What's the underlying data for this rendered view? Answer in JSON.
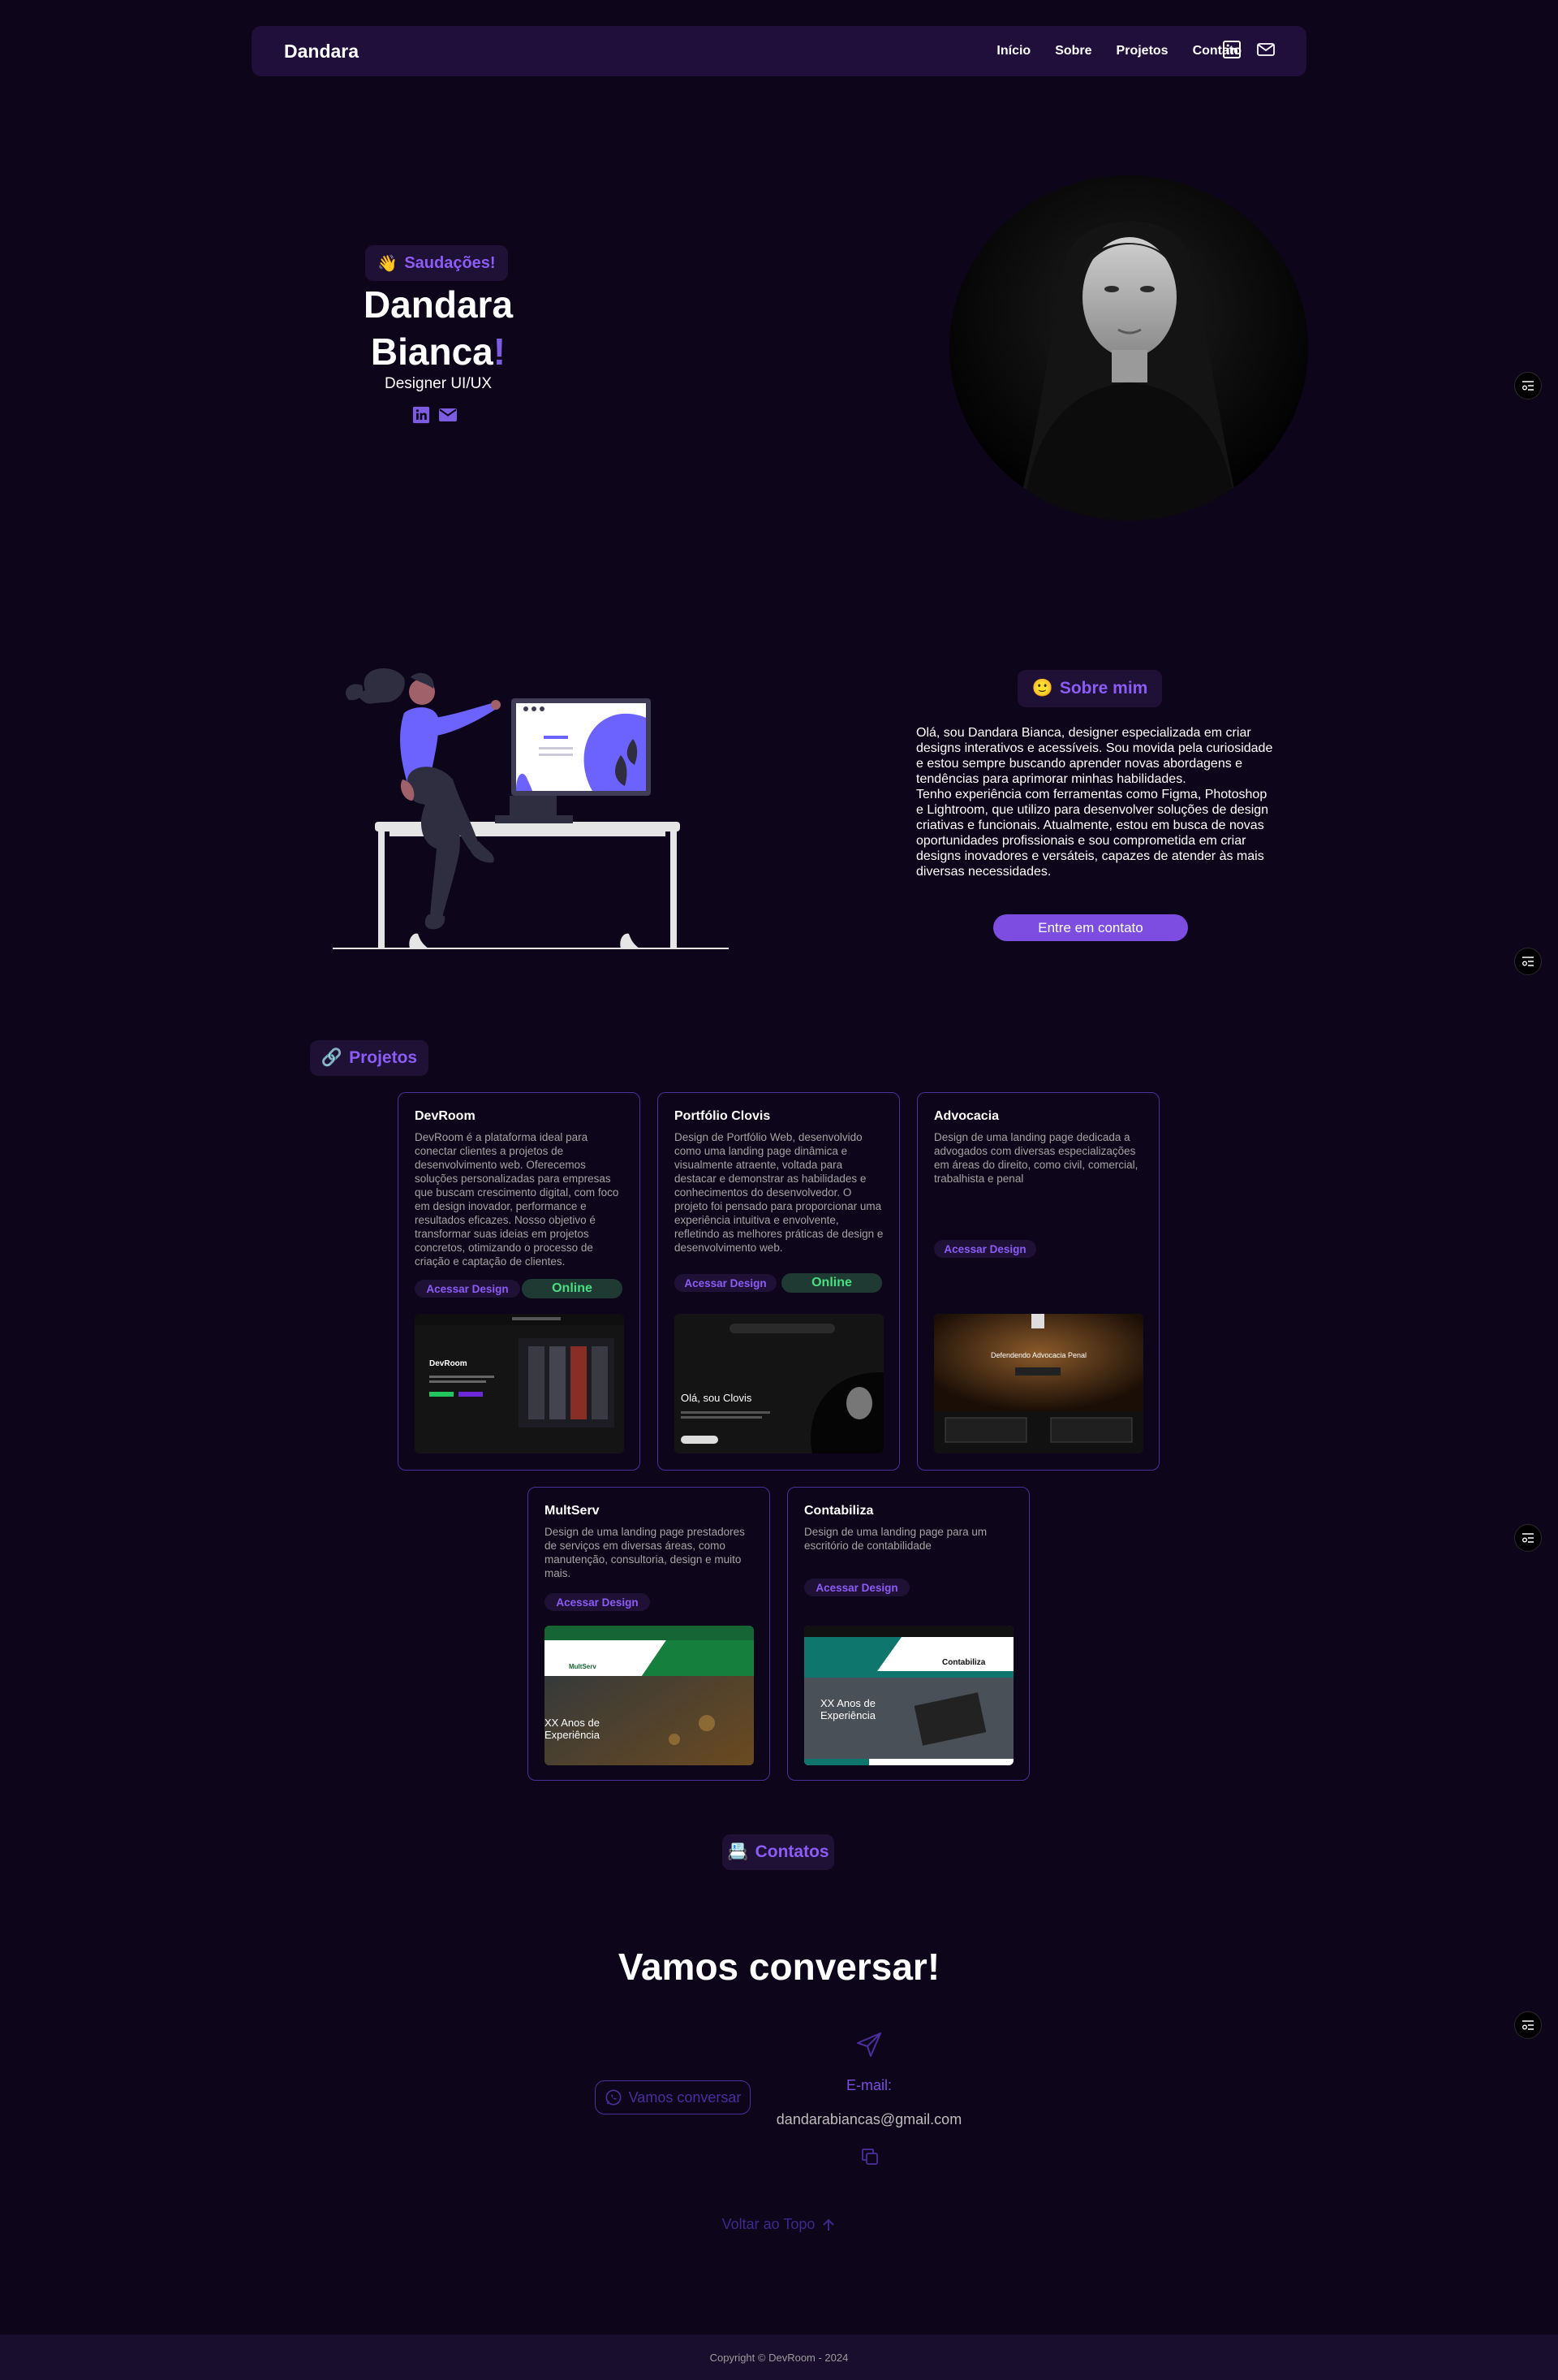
{
  "nav": {
    "brand": "Dandara",
    "links": [
      "Início",
      "Sobre",
      "Projetos",
      "Contato"
    ],
    "icons": [
      "linkedin-icon",
      "mail-icon"
    ]
  },
  "hero": {
    "greeting_emoji": "👋",
    "greeting": "Saudações!",
    "name_line1": "Dandara",
    "name_line2": "Bianca",
    "name_accent": "!",
    "role": "Designer UI/UX"
  },
  "about": {
    "pill_emoji": "🙂",
    "pill": "Sobre mim",
    "paragraph1": "Olá, sou Dandara Bianca, designer especializada em criar designs interativos e acessíveis. Sou movida pela curiosidade e estou sempre buscando aprender novas abordagens e tendências para aprimorar minhas habilidades.",
    "paragraph2": "Tenho experiência com ferramentas como Figma, Photoshop e Lightroom, que utilizo para desenvolver soluções de design criativas e funcionais. Atualmente, estou em busca de novas oportunidades profissionais e sou comprometida em criar designs inovadores e versáteis, capazes de atender às mais diversas necessidades.",
    "cta": "Entre em contato"
  },
  "projects": {
    "pill_emoji": "🔗",
    "pill": "Projetos",
    "access_label": "Acessar Design",
    "online_label": "Online",
    "cards": [
      {
        "title": "DevRoom",
        "desc": "DevRoom é a plataforma ideal para conectar clientes a projetos de desenvolvimento web. Oferecemos soluções personalizadas para empresas que buscam crescimento digital, com foco em design inovador, performance e resultados eficazes. Nosso objetivo é transformar suas ideias em projetos concretos, otimizando o processo de criação e captação de clientes.",
        "shot_heading": "DevRoom"
      },
      {
        "title": "Portfólio Clovis",
        "desc": "Design de Portfólio Web, desenvolvido como uma landing page dinâmica e visualmente atraente, voltada para destacar e demonstrar as habilidades e conhecimentos do desenvolvedor. O projeto foi pensado para proporcionar uma experiência intuitiva e envolvente, refletindo as melhores práticas de design e desenvolvimento web.",
        "shot_heading": "Olá, sou Clovis"
      },
      {
        "title": "Advocacia",
        "desc": "Design de uma landing page dedicada a advogados com diversas especializações em áreas do direito, como civil, comercial, trabalhista e penal",
        "shot_heading": "Defendendo Advocacia Penal"
      },
      {
        "title": "MultServ",
        "desc": "Design de uma landing page prestadores de serviços em diversas áreas, como manutenção, consultoria, design e muito mais.",
        "shot_heading": "XX Anos de Experiência",
        "shot_brand": "MultServ"
      },
      {
        "title": "Contabiliza",
        "desc": "Design de uma landing page para um escritório de contabilidade",
        "shot_heading": "XX Anos de Experiência",
        "shot_brand": "Contabiliza"
      }
    ]
  },
  "contact": {
    "pill_emoji": "📇",
    "pill": "Contatos",
    "title": "Vamos conversar!",
    "whatsapp": "Vamos conversar",
    "email_label": "E-mail:",
    "email": "dandarabiancas@gmail.com",
    "back_to_top": "Voltar ao Topo"
  },
  "footer": {
    "copyright": "Copyright © DevRoom - 2024"
  },
  "colors": {
    "background": "#0d0519",
    "accent": "#7c4de0",
    "online": "#4ade80"
  }
}
